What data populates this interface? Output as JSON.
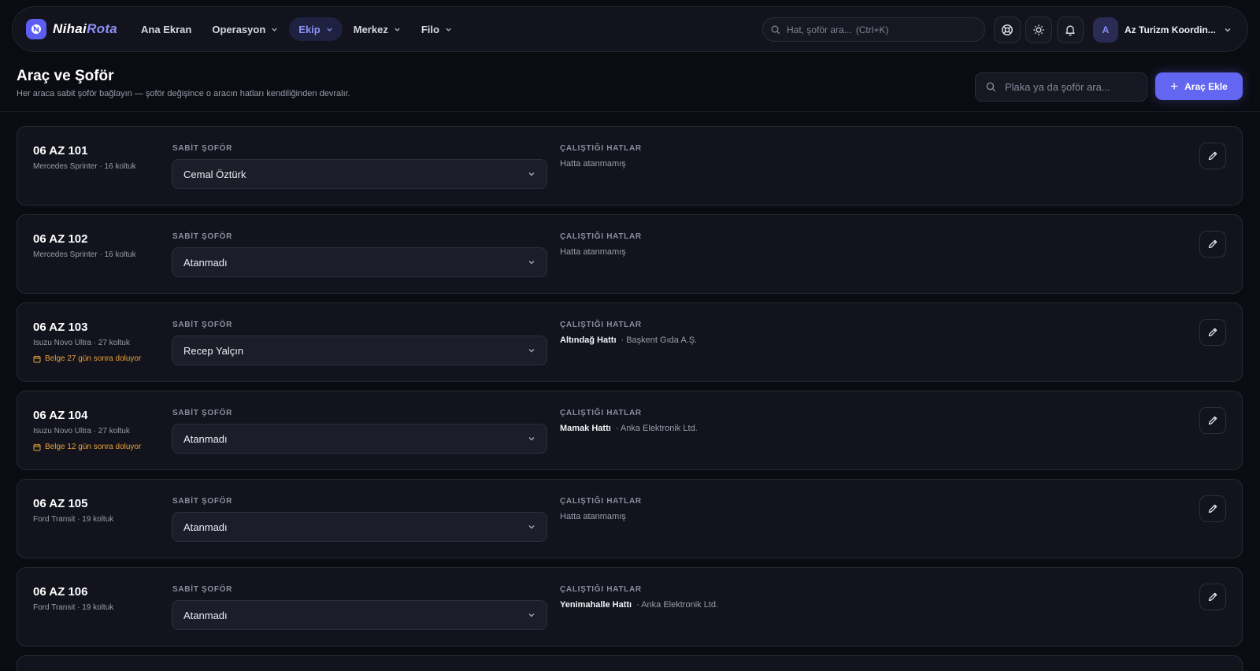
{
  "brand": {
    "part1": "Nihai",
    "part2": "Rota"
  },
  "nav": [
    {
      "label": "Ana Ekran",
      "has_menu": false,
      "active": false
    },
    {
      "label": "Operasyon",
      "has_menu": true,
      "active": false
    },
    {
      "label": "Ekip",
      "has_menu": true,
      "active": true
    },
    {
      "label": "Merkez",
      "has_menu": true,
      "active": false
    },
    {
      "label": "Filo",
      "has_menu": true,
      "active": false
    }
  ],
  "top_search": {
    "placeholder": "Hat, şoför ara...",
    "shortcut": "(Ctrl+K)"
  },
  "icons": [
    "support-icon",
    "sun-icon",
    "bell-icon"
  ],
  "user": {
    "initial": "A",
    "name": "Az Turizm Koordin..."
  },
  "page": {
    "title": "Araç ve Şoför",
    "subtitle": "Her araca sabit şoför bağlayın — şoför değişince o aracın hatları kendiliğinden devralır.",
    "search_placeholder": "Plaka ya da şoför ara...",
    "add_button": "Araç Ekle"
  },
  "labels": {
    "driver": "SABİT ŞOFÖR",
    "routes": "ÇALIŞTIĞI HATLAR"
  },
  "vehicles": [
    {
      "plate": "06 AZ 101",
      "model": "Mercedes Sprinter · 16 koltuk",
      "warning": "",
      "driver": "Cemal Öztürk",
      "route": "",
      "company": "",
      "no_route": "Hatta atanmamış"
    },
    {
      "plate": "06 AZ 102",
      "model": "Mercedes Sprinter · 16 koltuk",
      "warning": "",
      "driver": "Atanmadı",
      "route": "",
      "company": "",
      "no_route": "Hatta atanmamış"
    },
    {
      "plate": "06 AZ 103",
      "model": "Isuzu Novo Ultra · 27 koltuk",
      "warning": "Belge 27 gün sonra doluyor",
      "driver": "Recep Yalçın",
      "route": "Altındağ Hattı",
      "company": "· Başkent Gıda A.Ş.",
      "no_route": ""
    },
    {
      "plate": "06 AZ 104",
      "model": "Isuzu Novo Ultra · 27 koltuk",
      "warning": "Belge 12 gün sonra doluyor",
      "driver": "Atanmadı",
      "route": "Mamak Hattı",
      "company": "· Anka Elektronik Ltd.",
      "no_route": ""
    },
    {
      "plate": "06 AZ 105",
      "model": "Ford Transit · 19 koltuk",
      "warning": "",
      "driver": "Atanmadı",
      "route": "",
      "company": "",
      "no_route": "Hatta atanmamış"
    },
    {
      "plate": "06 AZ 106",
      "model": "Ford Transit · 19 koltuk",
      "warning": "",
      "driver": "Atanmadı",
      "route": "Yenimahalle Hattı",
      "company": "· Anka Elektronik Ltd.",
      "no_route": ""
    }
  ],
  "colors": {
    "accent": "#6366f1",
    "warning": "#e8a13a",
    "background": "#0b0c12",
    "card": "#12131c"
  }
}
